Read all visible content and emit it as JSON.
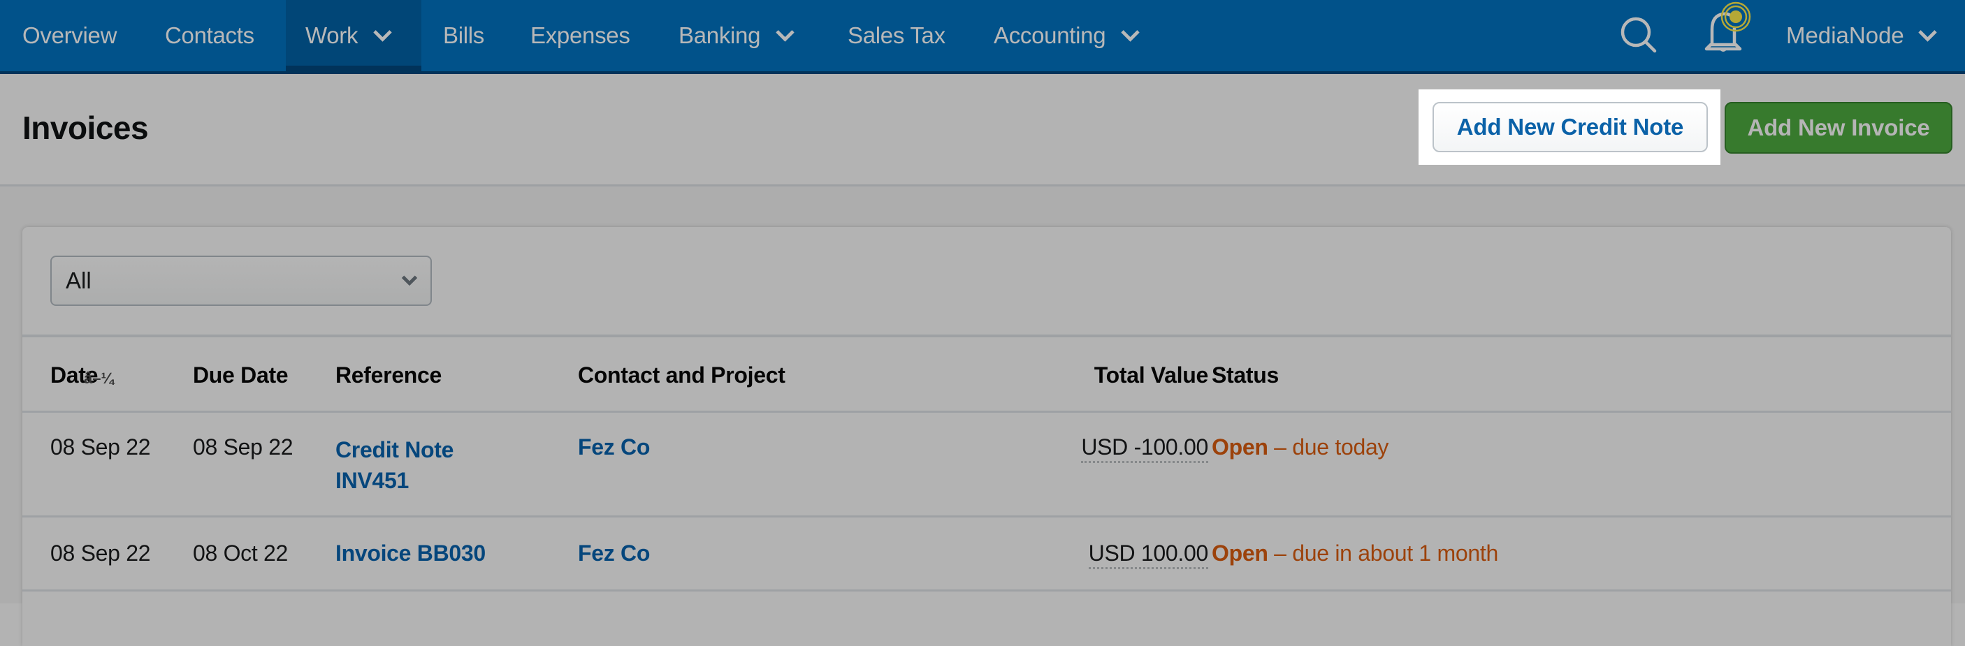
{
  "nav": {
    "items": [
      {
        "label": "Overview",
        "has_dropdown": false,
        "active": false
      },
      {
        "label": "Contacts",
        "has_dropdown": false,
        "active": false
      },
      {
        "label": "Work",
        "has_dropdown": true,
        "active": true
      },
      {
        "label": "Bills",
        "has_dropdown": false,
        "active": false
      },
      {
        "label": "Expenses",
        "has_dropdown": false,
        "active": false
      },
      {
        "label": "Banking",
        "has_dropdown": true,
        "active": false
      },
      {
        "label": "Sales Tax",
        "has_dropdown": false,
        "active": false
      },
      {
        "label": "Accounting",
        "has_dropdown": true,
        "active": false
      }
    ],
    "search_icon": "search-icon",
    "notifications_icon": "bell-icon",
    "user_menu_label": "MediaNode"
  },
  "header": {
    "title": "Invoices",
    "add_credit_note_label": "Add New Credit Note",
    "add_invoice_label": "Add New Invoice"
  },
  "filter": {
    "selected": "All"
  },
  "table": {
    "columns": [
      "Date",
      "Due Date",
      "Reference",
      "Contact and Project",
      "Total Value",
      "Status"
    ],
    "sort_indicator": "â–¼",
    "rows": [
      {
        "date": "08 Sep 22",
        "due_date": "08 Sep 22",
        "reference_line1": "Credit Note",
        "reference_line2": "INV451",
        "contact": "Fez Co",
        "total": "USD -100.00",
        "status": "Open",
        "status_detail": " – due today"
      },
      {
        "date": "08 Sep 22",
        "due_date": "08 Oct 22",
        "reference_line1": "Invoice BB030",
        "reference_line2": "",
        "contact": "Fez Co",
        "total": "USD 100.00",
        "status": "Open",
        "status_detail": " – due in about 1 month"
      }
    ]
  },
  "colors": {
    "nav_bg": "#01528a",
    "link": "#0b62a8",
    "primary_green": "#377a2d",
    "status_open": "#9c420b"
  }
}
